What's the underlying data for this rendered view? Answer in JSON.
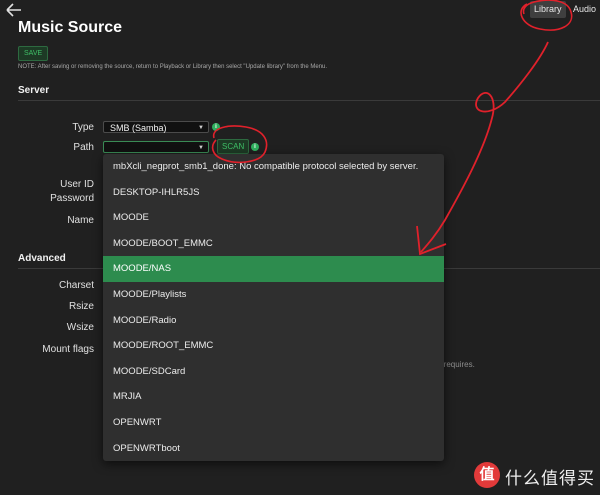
{
  "header": {
    "tabs": [
      {
        "label": "Library",
        "active": true
      },
      {
        "label": "Audio",
        "active": false
      }
    ]
  },
  "page": {
    "title": "Music Source",
    "save_label": "SAVE",
    "note": "NOTE: After saving or removing the source, return to Playback or Library then select \"Update library\" from the Menu."
  },
  "server": {
    "section_title": "Server",
    "type_label": "Type",
    "type_value": "SMB (Samba)",
    "path_label": "Path",
    "path_value": "",
    "scan_label": "SCAN",
    "userid_label": "User ID",
    "password_label": "Password",
    "name_label": "Name"
  },
  "advanced": {
    "section_title": "Advanced",
    "charset_label": "Charset",
    "rsize_label": "Rsize",
    "wsize_label": "Wsize",
    "mountflags_label": "Mount flags",
    "partial_hint": "e requires."
  },
  "dropdown": {
    "options": [
      "mbXcli_negprot_smb1_done: No compatible protocol selected by server.",
      "DESKTOP-IHLR5JS",
      "MOODE",
      "MOODE/BOOT_EMMC",
      "MOODE/NAS",
      "MOODE/Playlists",
      "MOODE/Radio",
      "MOODE/ROOT_EMMC",
      "MOODE/SDCard",
      "MRJIA",
      "OPENWRT",
      "OPENWRTboot"
    ],
    "selected_index": 4
  },
  "watermark": {
    "logo_char": "值",
    "text": "什么值得买"
  },
  "colors": {
    "accent": "#2d8c4e",
    "annotation": "#e0212b",
    "background": "#202020"
  }
}
